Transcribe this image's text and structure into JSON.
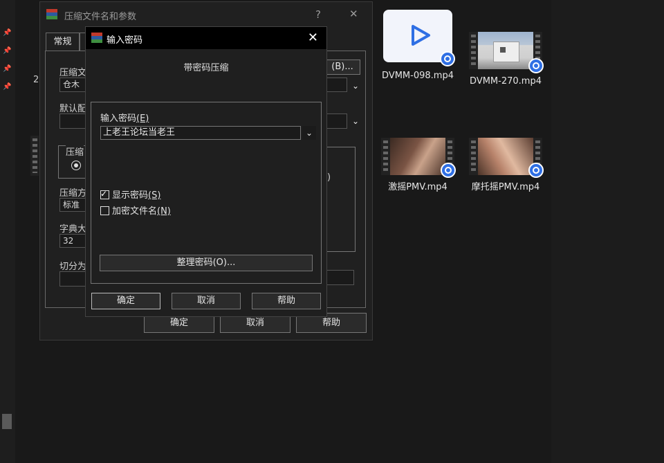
{
  "background": {
    "number_fragment": "2",
    "files": [
      {
        "name": "DVMM-098.mp4",
        "thumb": "play-icon-thumb"
      },
      {
        "name": "DVMM-270.mp4",
        "thumb": "building-photo"
      },
      {
        "name": "激摇PMV.mp4",
        "thumb": "video-frame"
      },
      {
        "name": "摩托摇PMV.mp4",
        "thumb": "video-frame"
      }
    ]
  },
  "back_dialog": {
    "title": "压缩文件名和参数",
    "help_glyph": "?",
    "close_glyph": "✕",
    "tab_general": "常规",
    "label_archive_name": "压缩文",
    "archive_name_value": "仓木",
    "browse_button": "(B)...",
    "label_default": "默认配",
    "label_format": "压缩",
    "label_method": "压缩方",
    "method_value": "标准",
    "label_dict": "字典大",
    "dict_value": "32",
    "label_split": "切分为",
    "paren_fragment": ")",
    "ok_button": "确定",
    "cancel_button": "取消",
    "help_button": "帮助"
  },
  "front_dialog": {
    "title": "输入密码",
    "close_glyph": "✕",
    "subtitle": "带密码压缩",
    "label_enter_password": "输入密码",
    "label_enter_password_key": "(E)",
    "password_value": "上老王论坛当老王",
    "show_password_label": "显示密码",
    "show_password_key": "(S)",
    "show_password_checked": true,
    "encrypt_filenames_label": "加密文件名",
    "encrypt_filenames_key": "(N)",
    "encrypt_filenames_checked": false,
    "organize_button": "整理密码(O)...",
    "ok_button": "确定",
    "cancel_button": "取消",
    "help_button": "帮助"
  },
  "colors": {
    "background": "#191919",
    "dialog": "#1f1f1f",
    "badge": "#2f6fe4",
    "winrar_red": "#c0392b",
    "winrar_blue": "#2c5aa0",
    "winrar_green": "#3e8e41"
  }
}
